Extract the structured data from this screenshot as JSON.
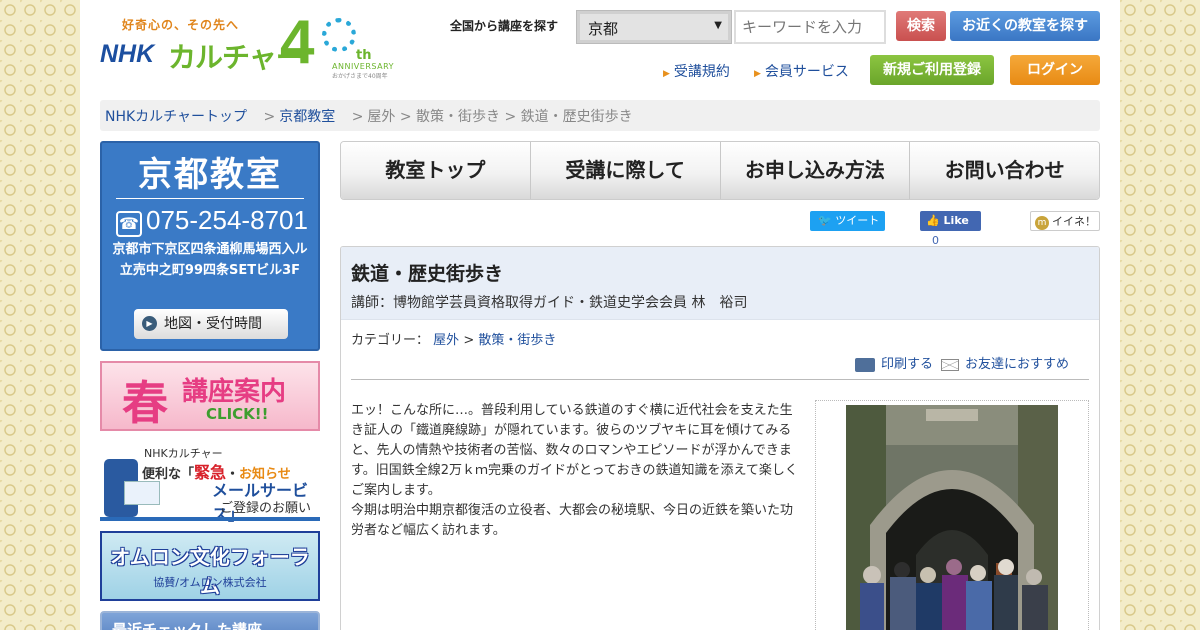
{
  "header": {
    "logo_slogan": "好奇心の、その先へ",
    "logo_nhk": "NHK",
    "logo_culture": "カルチャー",
    "logo_forty": "4",
    "logo_th": "th",
    "logo_anniversary": "ANNIVERSARY",
    "logo_sub": "おかげさまで40周年",
    "search_label": "全国から講座を探す",
    "region_selected": "京都",
    "keyword_placeholder": "キーワードを入力",
    "search_button": "検索",
    "nearby_button": "お近くの教室を探す",
    "terms_link": "受講規約",
    "member_link": "会員サービス",
    "register_button": "新規ご利用登録",
    "login_button": "ログイン"
  },
  "breadcrumb": {
    "top": "NHKカルチャートップ",
    "school": "京都教室",
    "path": "屋外 > 散策・街歩き > 鉄道・歴史街歩き"
  },
  "school": {
    "name": "京都教室",
    "tel": "075-254-8701",
    "address_1": "京都市下京区四条通柳馬場西入ル",
    "address_2": "立売中之町99四条SETビル3F",
    "map_button": "地図・受付時間"
  },
  "banners": {
    "spring_big": "春",
    "spring_text": "講座案内",
    "spring_click": "CLICK!!",
    "mail_line1": "NHKカルチャー",
    "mail_benri": "便利な「",
    "mail_urgent": "緊急",
    "mail_dot": "・",
    "mail_notice": "お知らせ",
    "mail_service": "メールサービス」",
    "mail_please": "ご登録のお願い",
    "omron_title": "オムロン文化フォーラム",
    "omron_sub": "協賛/オムロン株式会社",
    "recent_title": "最近チェックした講座"
  },
  "nav": {
    "items": [
      "教室トップ",
      "受講に際して",
      "お申し込み方法",
      "お問い合わせ"
    ]
  },
  "social": {
    "tweet": "ツイート",
    "like": "Like",
    "like_count": "0",
    "iine": "イイネ！"
  },
  "course": {
    "title": "鉄道・歴史街歩き",
    "lecturer": "講師：博物館学芸員資格取得ガイド・鉄道史学会会員 林　裕司",
    "category_label": "カテゴリー：",
    "category_1": "屋外",
    "category_2": "散策・街歩き",
    "print_link": "印刷する",
    "friend_link": "お友達におすすめ",
    "description_1": "エッ！こんな所に…。普段利用している鉄道のすぐ横に近代社会を支えた生き証人の「鐵道廃線跡」が隠れています。彼らのツブヤキに耳を傾けてみると、先人の情熱や技術者の苦悩、数々のロマンやエピソードが浮かんできます。旧国鉄全線2万ｋｍ完乗のガイドがとっておきの鉄道知識を添えて楽しくご案内します。",
    "description_2": "今期は明治中期京都復活の立役者、大都会の秘境駅、今日の近鉄を築いた功労者など幅広く訪れます。"
  }
}
